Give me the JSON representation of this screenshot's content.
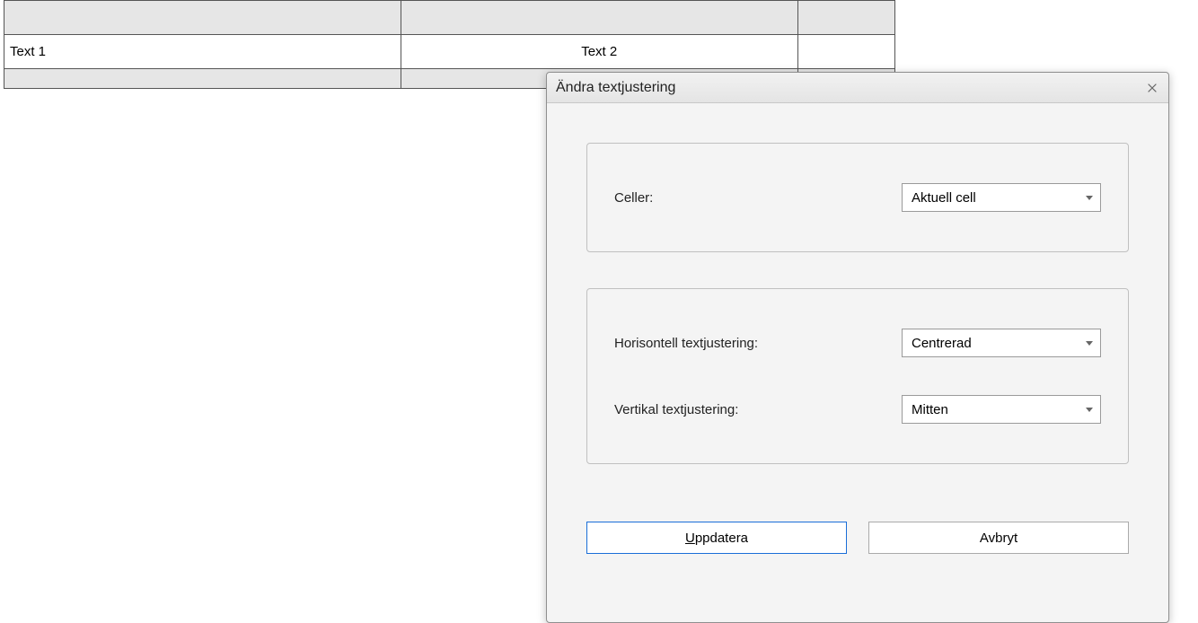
{
  "table": {
    "rows": [
      {
        "cells": [
          "",
          "",
          ""
        ]
      },
      {
        "cells": [
          "Text 1",
          "Text 2",
          ""
        ]
      },
      {
        "cells": [
          "",
          "",
          ""
        ]
      }
    ],
    "selected_cell_bg": "#cfe6ff"
  },
  "dialog": {
    "title": "Ändra textjustering",
    "group_cells": {
      "label": "Celler:",
      "value": "Aktuell cell"
    },
    "group_align": {
      "h_label": "Horisontell textjustering:",
      "h_value": "Centrerad",
      "v_label": "Vertikal textjustering:",
      "v_value": "Mitten"
    },
    "buttons": {
      "update_full": "Uppdatera",
      "update_pre": "",
      "update_acc": "U",
      "update_post": "ppdatera",
      "cancel": "Avbryt"
    }
  }
}
